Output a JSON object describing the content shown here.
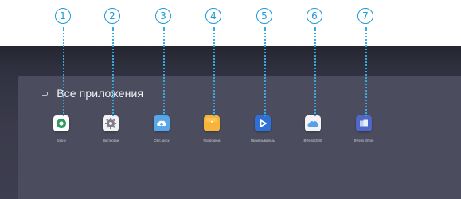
{
  "callouts": [
    "1",
    "2",
    "3",
    "4",
    "5",
    "6",
    "7"
  ],
  "header": {
    "back_icon": "back-arrow-icon",
    "title": "Все приложения"
  },
  "apps": [
    {
      "label": "Вэдну",
      "icon": "browser-icon",
      "color": "#ffffff"
    },
    {
      "label": "Настройки",
      "icon": "gear-icon",
      "color": "#f2f2f4"
    },
    {
      "label": "Обл. диск",
      "icon": "cloud-upload-icon",
      "color": "#57a6ea"
    },
    {
      "label": "Проводник",
      "icon": "folder-icon",
      "color": "#f7b43b"
    },
    {
      "label": "Проигрыватель",
      "icon": "play-icon",
      "color": "#2f6fd8"
    },
    {
      "label": "Bytello DMS",
      "icon": "cloud-icon",
      "color": "#f4f4f6"
    },
    {
      "label": "Bytello Share",
      "icon": "share-icon",
      "color": "#4f68c7"
    }
  ]
}
